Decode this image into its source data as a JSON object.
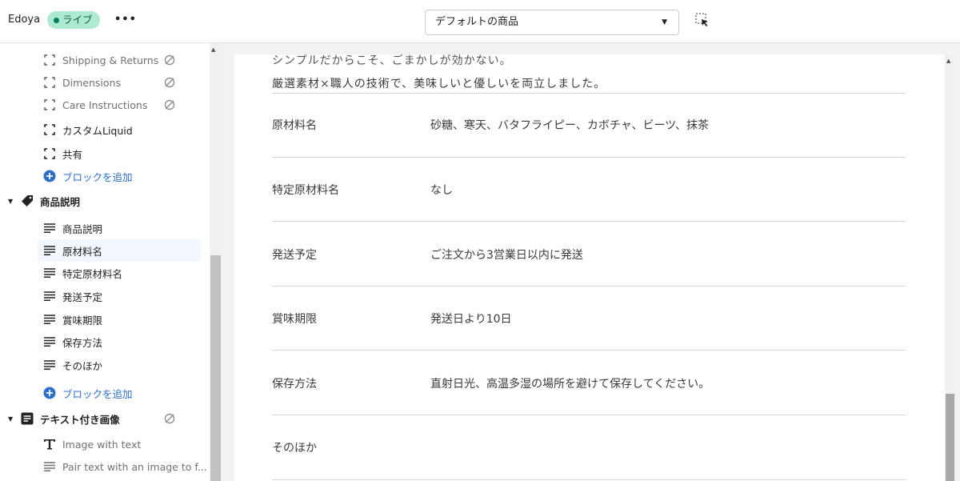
{
  "topbar": {
    "store_name": "Edoya",
    "live_badge": "ライブ",
    "more_label": "•••",
    "template_select": {
      "value": "デフォルトの商品",
      "caret": "▼"
    }
  },
  "sidebar": {
    "items": [
      {
        "label": "Shipping & Returns",
        "icon": "block-bracket-icon",
        "hidden": true
      },
      {
        "label": "Dimensions",
        "icon": "block-bracket-icon",
        "hidden": true
      },
      {
        "label": "Care Instructions",
        "icon": "block-bracket-icon",
        "hidden": true
      },
      {
        "label": "カスタムLiquid",
        "icon": "block-bracket-icon"
      },
      {
        "label": "共有",
        "icon": "block-bracket-icon"
      },
      {
        "label": "ブロックを追加",
        "icon": "plus-circle-icon"
      },
      {
        "label": "商品説明",
        "icon": "tag-icon",
        "section": true
      },
      {
        "label": "商品説明",
        "icon": "text-lines-icon"
      },
      {
        "label": "原材料名",
        "icon": "text-lines-icon",
        "selected": true
      },
      {
        "label": "特定原材料名",
        "icon": "text-lines-icon"
      },
      {
        "label": "発送予定",
        "icon": "text-lines-icon"
      },
      {
        "label": "賞味期限",
        "icon": "text-lines-icon"
      },
      {
        "label": "保存方法",
        "icon": "text-lines-icon"
      },
      {
        "label": "そのほか",
        "icon": "text-lines-icon"
      },
      {
        "label": "ブロックを追加",
        "icon": "plus-circle-icon"
      },
      {
        "label": "テキスト付き画像",
        "icon": "text-image-icon",
        "section": true,
        "hidden": true
      },
      {
        "label": "Image with text",
        "icon": "text-t-icon"
      },
      {
        "label": "Pair text with an image to f...",
        "icon": "text-lines-icon"
      }
    ]
  },
  "preview": {
    "intro_line1": "シンプルだからこそ、ごまかしが効かない。",
    "intro_line2": "厳選素材×職人の技術で、美味しいと優しいを両立しました。",
    "rows": [
      {
        "label": "原材料名",
        "value": "砂糖、寒天、バタフライピー、カボチャ、ビーツ、抹茶"
      },
      {
        "label": "特定原材料名",
        "value": "なし"
      },
      {
        "label": "発送予定",
        "value": "ご注文から3営業日以内に発送"
      },
      {
        "label": "賞味期限",
        "value": "発送日より10日"
      },
      {
        "label": "保存方法",
        "value": "直射日光、高温多湿の場所を避けて保存してください。"
      },
      {
        "label": "そのほか",
        "value": ""
      }
    ]
  },
  "colors": {
    "accent_blue": "#2c6ecb",
    "live_badge_bg": "#aee9d1",
    "selected_row_bg": "#f2f7fe"
  }
}
